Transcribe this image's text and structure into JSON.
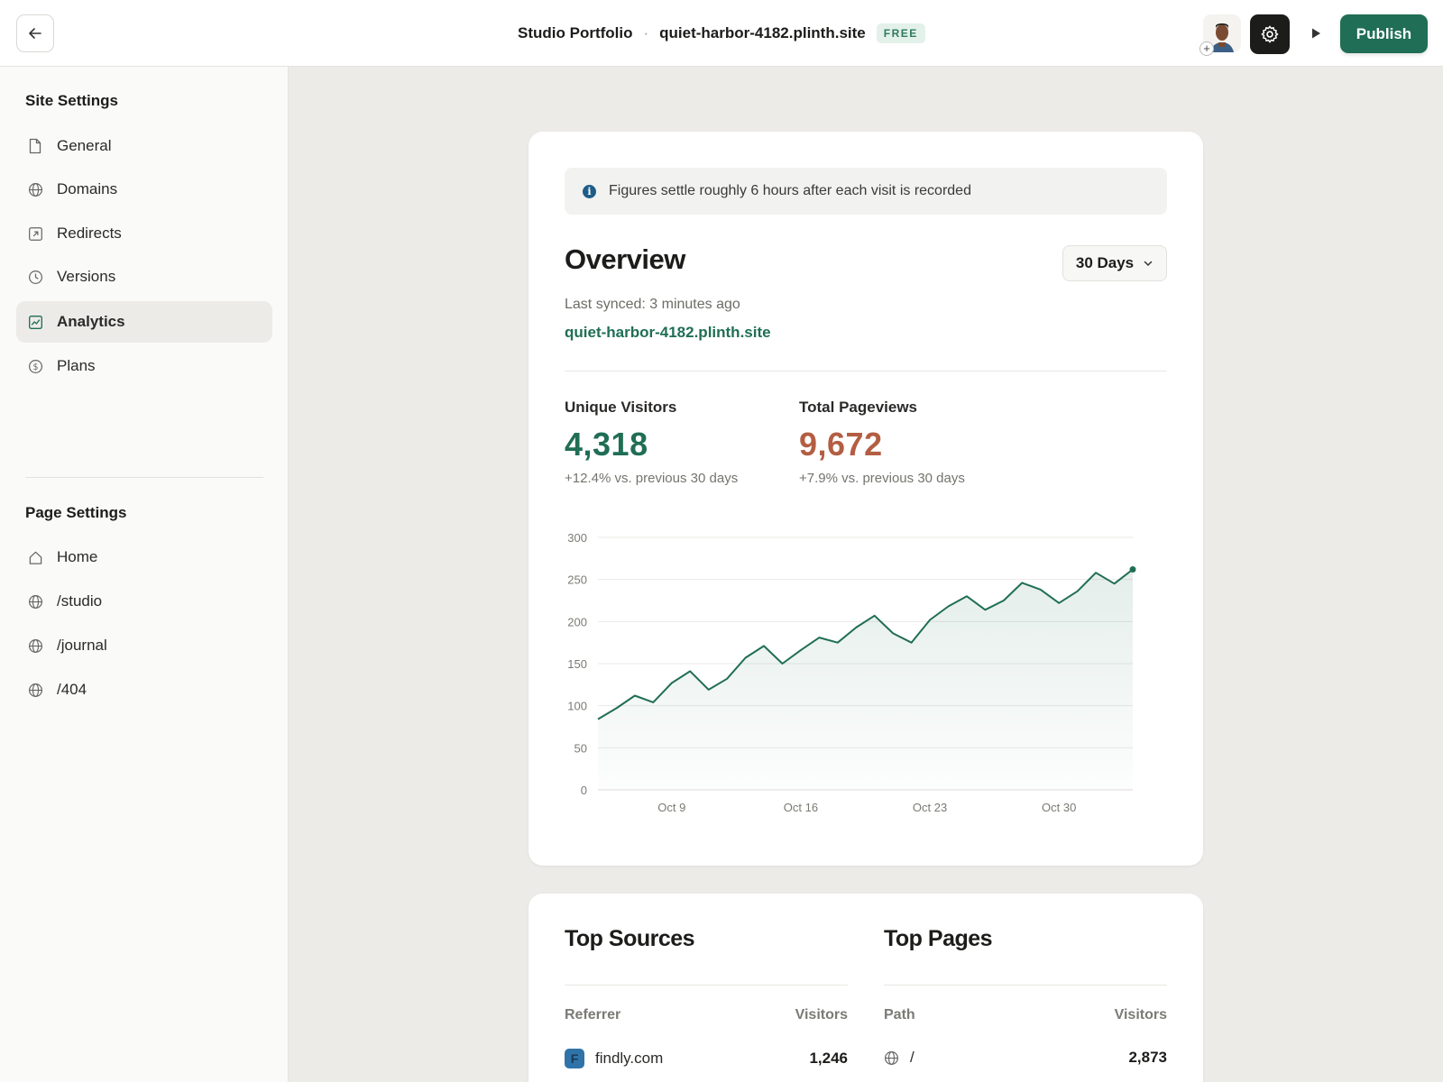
{
  "header": {
    "project_name": "Studio Portfolio",
    "separator": "·",
    "domain": "quiet-harbor-4182.plinth.site",
    "plan_badge": "FREE",
    "publish_label": "Publish"
  },
  "sidebar": {
    "site_heading": "Site Settings",
    "site_items": [
      {
        "label": "General",
        "icon": "document-icon"
      },
      {
        "label": "Domains",
        "icon": "globe-icon"
      },
      {
        "label": "Redirects",
        "icon": "redirect-icon"
      },
      {
        "label": "Versions",
        "icon": "clock-icon"
      },
      {
        "label": "Analytics",
        "icon": "chart-icon",
        "active": true
      },
      {
        "label": "Plans",
        "icon": "dollar-icon"
      }
    ],
    "page_heading": "Page Settings",
    "page_items": [
      {
        "label": "Home",
        "icon": "home-icon"
      },
      {
        "label": "/studio",
        "icon": "globe-icon"
      },
      {
        "label": "/journal",
        "icon": "globe-icon"
      },
      {
        "label": "/404",
        "icon": "globe-icon"
      }
    ]
  },
  "overview": {
    "notice": "Figures settle roughly 6 hours after each visit is recorded",
    "title": "Overview",
    "range": "30 Days",
    "last_synced": "Last synced: 3 minutes ago",
    "site_link": "quiet-harbor-4182.plinth.site",
    "unique_visitors": {
      "label": "Unique Visitors",
      "value": "4,318",
      "delta": "+12.4% vs. previous 30 days"
    },
    "total_pageviews": {
      "label": "Total Pageviews",
      "value": "9,672",
      "delta": "+7.9% vs. previous 30 days"
    }
  },
  "chart_data": {
    "type": "area",
    "x_tick_labels": [
      "Oct 9",
      "Oct 16",
      "Oct 23",
      "Oct 30"
    ],
    "x_tick_index": [
      4,
      11,
      18,
      25
    ],
    "y_ticks": [
      0,
      50,
      100,
      150,
      200,
      250,
      300
    ],
    "ylim": [
      0,
      300
    ],
    "values": [
      84,
      97,
      112,
      104,
      127,
      141,
      119,
      132,
      157,
      171,
      150,
      166,
      181,
      175,
      193,
      207,
      186,
      175,
      202,
      218,
      230,
      214,
      225,
      246,
      238,
      222,
      236,
      258,
      245,
      262
    ],
    "line_color": "#1f6e55",
    "grid": true
  },
  "sources": {
    "title": "Top Sources",
    "col_name": "Referrer",
    "col_value": "Visitors",
    "rows": [
      {
        "name": "findly.com",
        "value": "1,246",
        "favicon_letter": "F"
      }
    ]
  },
  "pages": {
    "title": "Top Pages",
    "col_name": "Path",
    "col_value": "Visitors",
    "rows": [
      {
        "name": "/",
        "value": "2,873"
      }
    ]
  },
  "colors": {
    "accent": "#1f6e55",
    "pageviews": "#b35e42",
    "info": "#1f5d88"
  }
}
